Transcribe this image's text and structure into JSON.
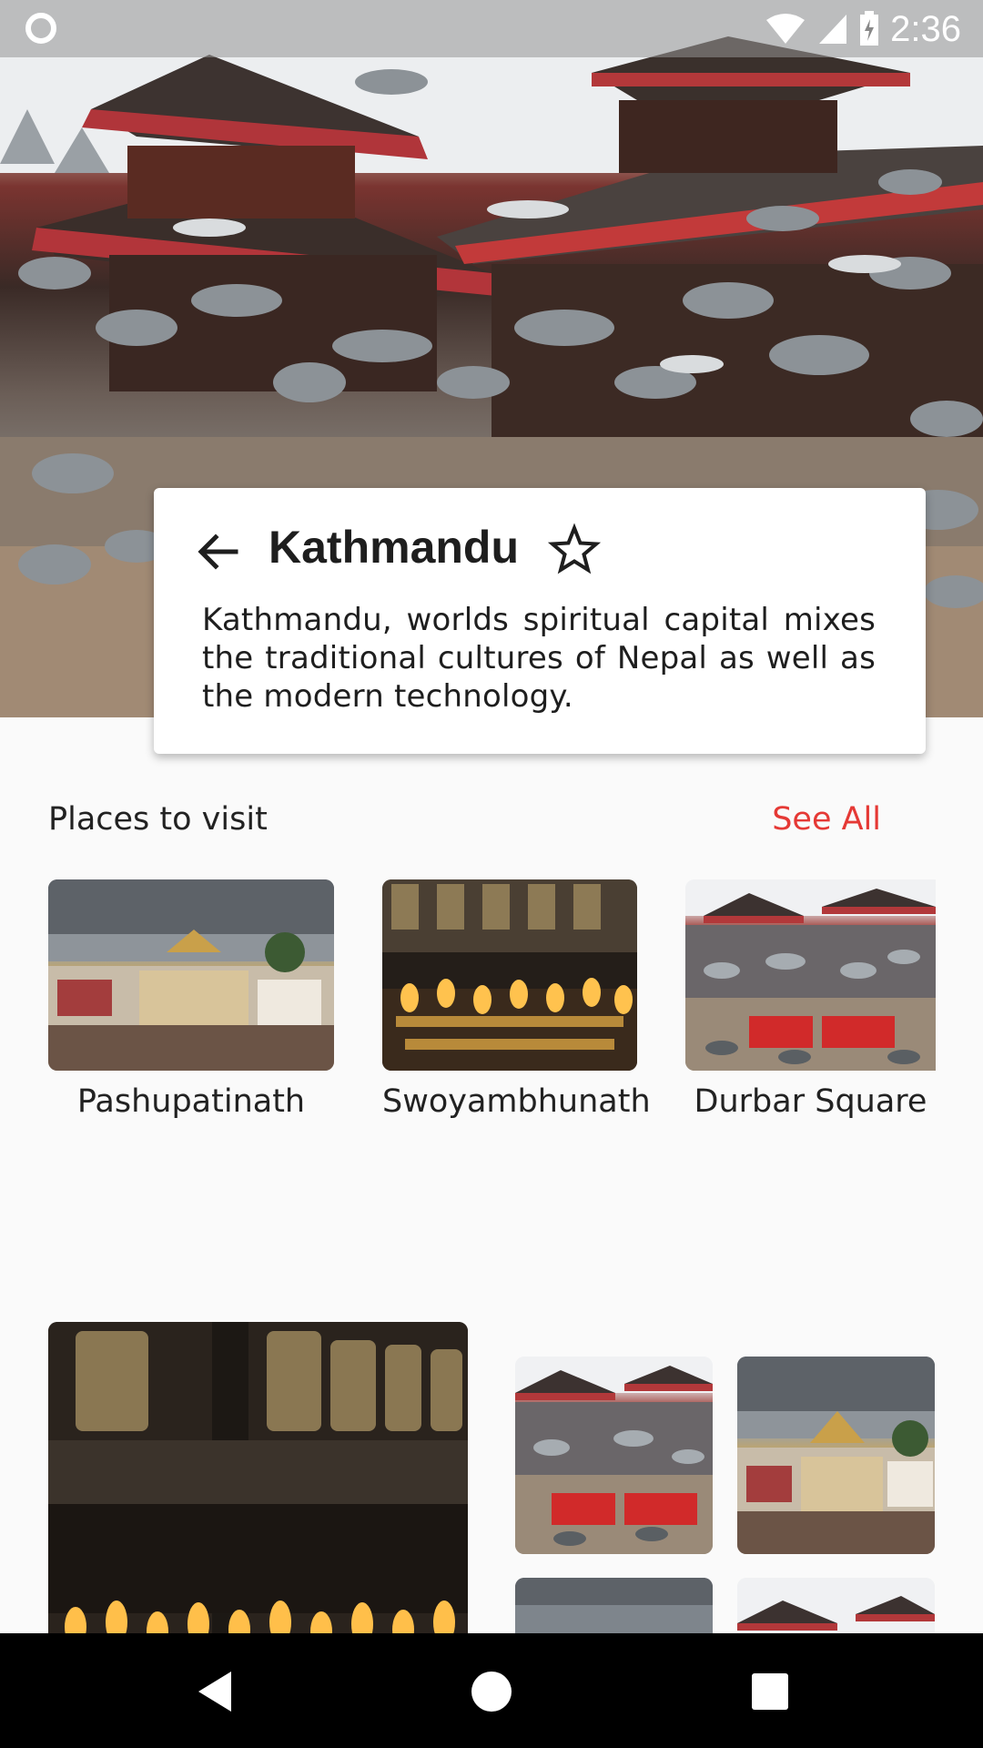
{
  "status_bar": {
    "time": "2:36"
  },
  "hero": {
    "image": "kathmandu-durbar-square-pigeons"
  },
  "info_card": {
    "title": "Kathmandu",
    "description": "Kathmandu, worlds spiritual capital mixes the traditional cultures of Nepal as well as the modern technology."
  },
  "places": {
    "title": "Places to visit",
    "see_all": "See All",
    "items": [
      {
        "name": "Pashupatinath",
        "image": "pashupatinath-temple"
      },
      {
        "name": "Swoyambhunath",
        "image": "butter-lamps-prayer-wheels"
      },
      {
        "name": "Durbar Square",
        "image": "durbar-square-pigeons"
      }
    ]
  },
  "gallery": {
    "items": [
      {
        "image": "butter-lamps-prayer-wheels"
      },
      {
        "image": "durbar-square-pigeons"
      },
      {
        "image": "pashupatinath-temple"
      },
      {
        "image": "pashupatinath-temple"
      },
      {
        "image": "durbar-square-pigeons"
      }
    ]
  },
  "colors": {
    "accent": "#e53935",
    "background": "#fafafa",
    "nav_bar": "#000000"
  }
}
